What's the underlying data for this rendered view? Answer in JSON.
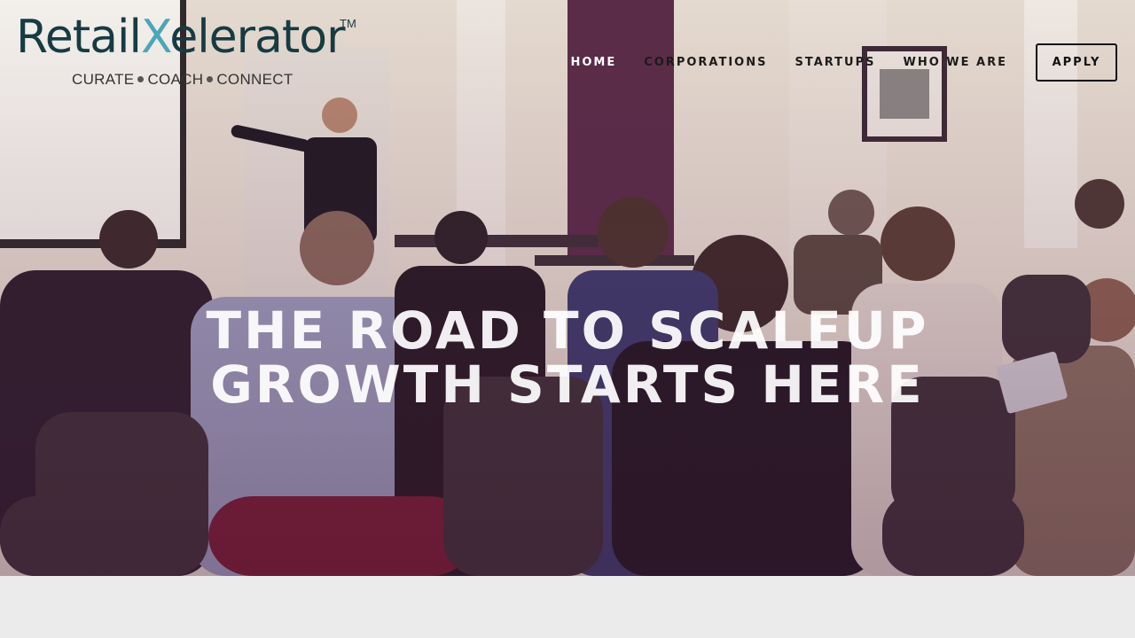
{
  "brand": {
    "name_part1": "Retail",
    "name_x": "X",
    "name_part2": "elerator",
    "trademark": "TM",
    "tagline_1": "CURATE",
    "tagline_2": "COACH",
    "tagline_3": "CONNECT",
    "colors": {
      "dark": "#163b43",
      "accent": "#4aa6b8"
    }
  },
  "nav": {
    "items": [
      {
        "label": "HOME"
      },
      {
        "label": "CORPORATIONS"
      },
      {
        "label": "STARTUPS"
      },
      {
        "label": "WHO WE ARE"
      }
    ],
    "cta_label": "APPLY"
  },
  "hero": {
    "headline_line1": "THE ROAD TO SCALEUP",
    "headline_line2": "GROWTH STARTS HERE",
    "image": "conference-room-presentation-photo"
  }
}
